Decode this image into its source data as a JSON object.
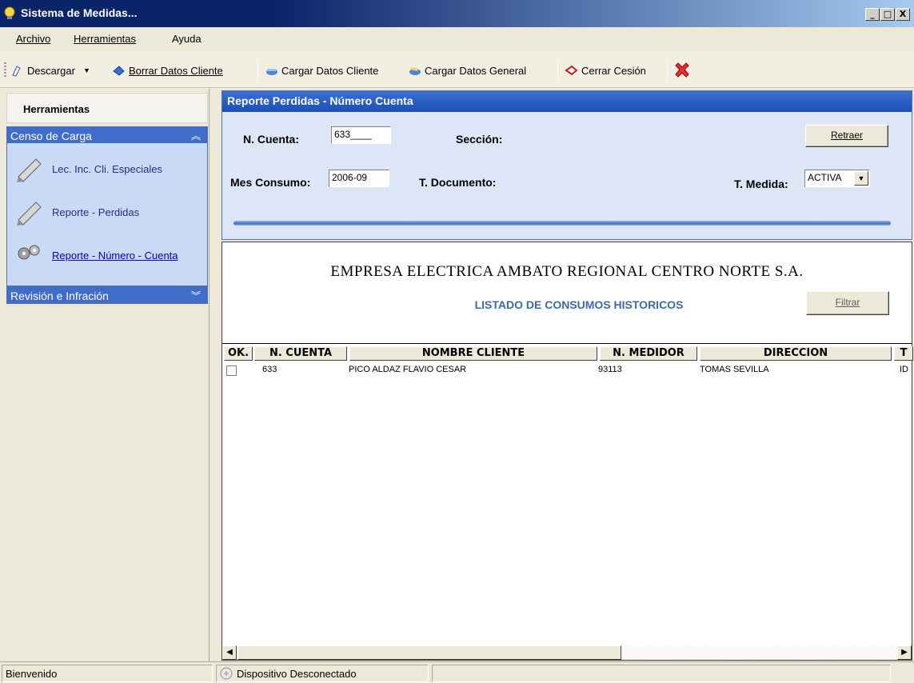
{
  "window": {
    "title": "Sistema de Medidas...",
    "min": "_",
    "max": "□",
    "close": "X"
  },
  "menu": {
    "items": [
      "Archivo",
      "Herramientas",
      "Ayuda"
    ]
  },
  "toolbar": {
    "descargar": "Descargar",
    "borrar": "Borrar Datos Cliente",
    "cargar_cliente": "Cargar Datos Cliente",
    "cargar_general": "Cargar Datos General",
    "cerrar": "Cerrar Cesión"
  },
  "sidebar": {
    "header": "Herramientas",
    "group1": "Censo de Carga",
    "items": [
      "Lec. Inc. Cli. Especiales",
      "Reporte - Perdidas",
      "Reporte - Número - Cuenta"
    ],
    "group2": "Revisión e Infración"
  },
  "form": {
    "title": "Reporte Perdidas - Número Cuenta",
    "cuenta_label": "N. Cuenta:",
    "cuenta_value": "633____",
    "seccion_label": "Sección:",
    "retraer": "Retraer",
    "mes_label": "Mes Consumo:",
    "mes_value": "2006-09",
    "tdoc_label": "T. Documento:",
    "tmedida_label": "T. Medida:",
    "tmedida_value": "ACTIVA"
  },
  "report": {
    "company": "EMPRESA ELECTRICA AMBATO REGIONAL CENTRO NORTE S.A.",
    "subtitle": "LISTADO DE CONSUMOS HISTORICOS",
    "filtrar": "Filtrar",
    "columns": [
      "OK.",
      "N. CUENTA",
      "NOMBRE CLIENTE",
      "N. MEDIDOR",
      "DIRECCION",
      "T"
    ],
    "rows": [
      {
        "cuenta": "633",
        "nombre": "PICO ALDAZ FLAVIO CESAR",
        "medidor": "93113",
        "direccion": "TOMAS SEVILLA",
        "t": "ID"
      }
    ]
  },
  "status": {
    "left": "Bienvenido",
    "device": "Dispositivo Desconectado"
  }
}
